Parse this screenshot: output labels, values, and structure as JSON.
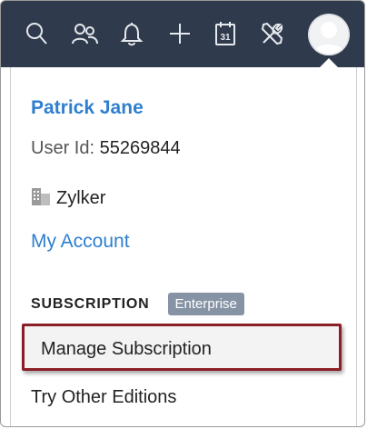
{
  "topbar": {
    "icons": [
      "search-icon",
      "contacts-icon",
      "bell-icon",
      "plus-icon",
      "calendar-icon",
      "tools-icon"
    ],
    "calendar_day": "31",
    "background": "#2f3a4c"
  },
  "user": {
    "name": "Patrick Jane",
    "id_label": "User Id:",
    "id_value": "55269844",
    "org_name": "Zylker"
  },
  "menu": {
    "my_account": "My Account",
    "subscription_heading": "SUBSCRIPTION",
    "subscription_badge": "Enterprise",
    "manage_subscription": "Manage Subscription",
    "try_other_editions": "Try Other Editions"
  },
  "colors": {
    "link": "#2f7fcf",
    "badge": "#8593a5",
    "highlight_border": "#8b1e26"
  }
}
